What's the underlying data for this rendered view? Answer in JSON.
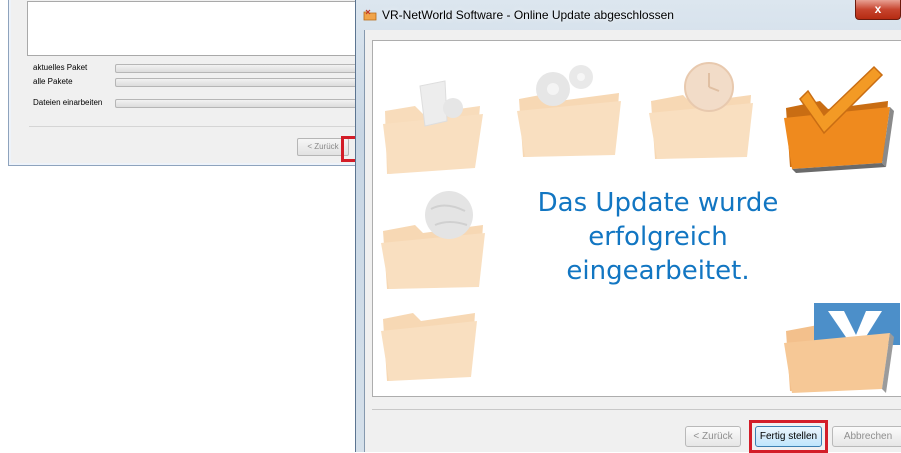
{
  "background_window": {
    "progress_rows": [
      {
        "label": "aktuelles Paket"
      },
      {
        "label": "alle Pakete"
      },
      {
        "label": "Dateien einarbeiten"
      }
    ],
    "back_label": "< Zurück"
  },
  "dialog": {
    "title": "VR-NetWorld Software - Online Update abgeschlossen",
    "close_label": "x",
    "message_lines": [
      "Das Update wurde",
      "erfolgreich",
      "eingearbeitet."
    ],
    "buttons": {
      "back": "< Zurück",
      "finish": "Fertig stellen",
      "cancel": "Abbrechen"
    }
  },
  "colors": {
    "headline": "#1276c2",
    "highlight": "#d31d28",
    "folder_faded": "#f7d5ad",
    "folder_active": "#ef8a1e"
  }
}
